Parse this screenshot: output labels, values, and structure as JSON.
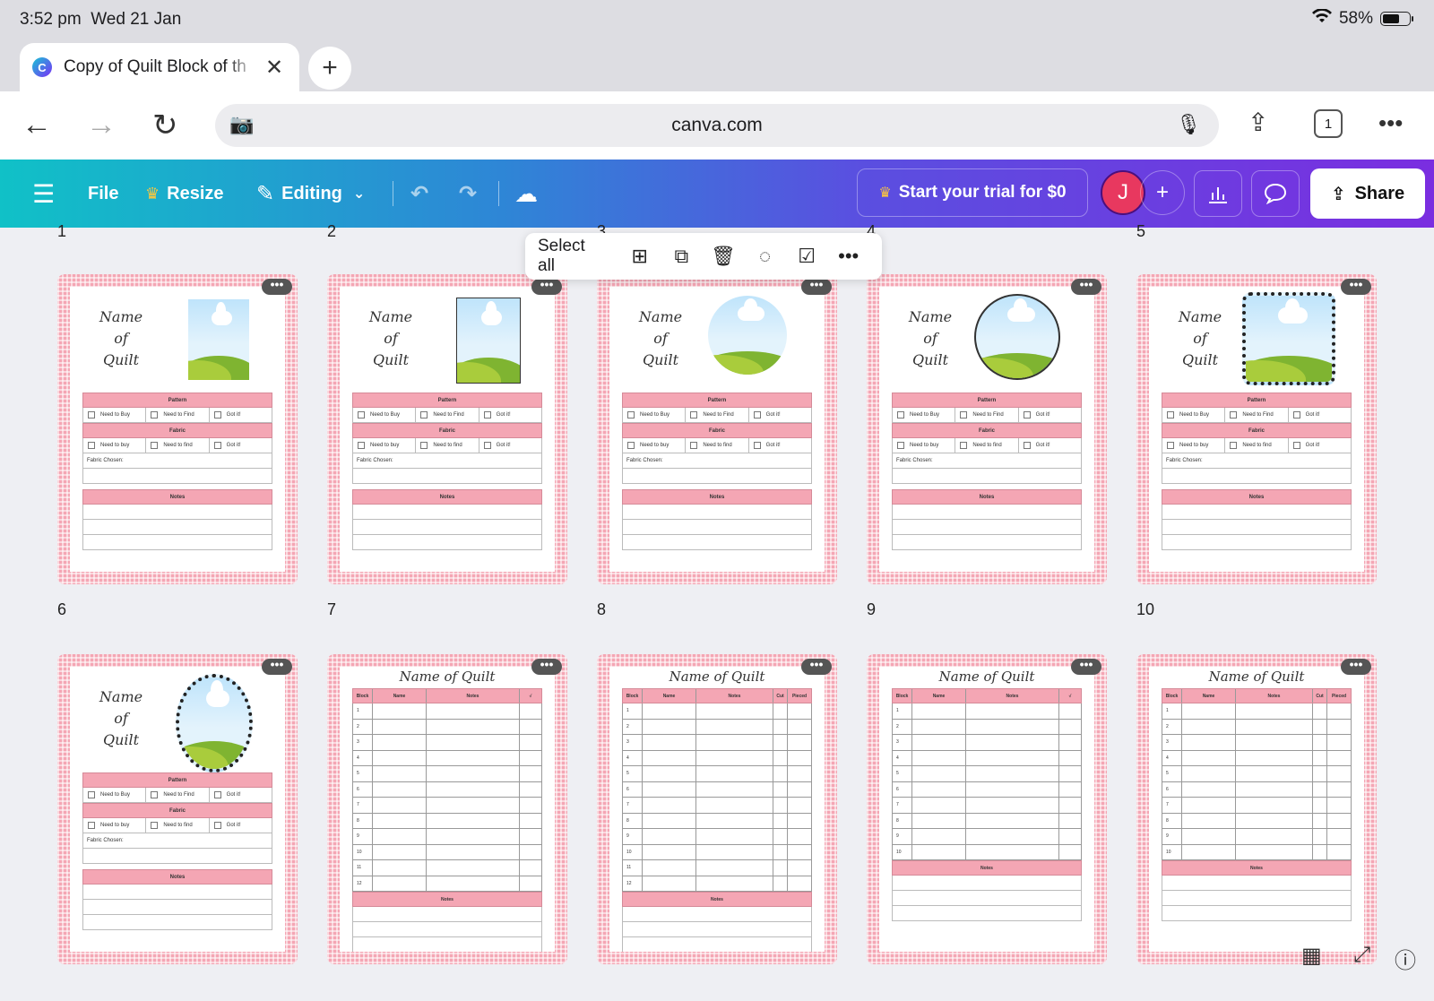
{
  "status": {
    "time": "3:52 pm",
    "date": "Wed 21 Jan",
    "battery": "58%",
    "battery_level": 0.58
  },
  "browser": {
    "tab_title": "Copy of Quilt Block of th",
    "url": "canva.com",
    "tab_count": "1"
  },
  "toolbar": {
    "file": "File",
    "resize": "Resize",
    "editing": "Editing",
    "trial": "Start your trial for $0",
    "avatar": "J",
    "share": "Share"
  },
  "context_menu": {
    "select_all": "Select all"
  },
  "pages": [
    {
      "num": "1",
      "kind": "cover"
    },
    {
      "num": "2",
      "kind": "cover"
    },
    {
      "num": "3",
      "kind": "cover"
    },
    {
      "num": "4",
      "kind": "cover"
    },
    {
      "num": "5",
      "kind": "cover"
    },
    {
      "num": "6",
      "kind": "cover"
    },
    {
      "num": "7",
      "kind": "table"
    },
    {
      "num": "8",
      "kind": "table"
    },
    {
      "num": "9",
      "kind": "table"
    },
    {
      "num": "10",
      "kind": "table"
    }
  ],
  "cover": {
    "title_line1": "Name",
    "title_line2": "of",
    "title_line3": "Quilt",
    "pattern": "Pattern",
    "need_to_buy": "Need to Buy",
    "need_to_find": "Need to Find",
    "got_it": "Got it!",
    "fabric": "Fabric",
    "need_to_buy_lc": "Need to buy",
    "need_to_find_lc": "Need to find",
    "fabric_chosen": "Fabric Chosen:",
    "notes": "Notes"
  },
  "table_page": {
    "title": "Name of Quilt",
    "col_block": "Block",
    "col_name": "Name",
    "col_notes": "Notes",
    "col_check": "√",
    "col_cut": "Cut",
    "col_pieced": "Pieced",
    "notes": "Notes"
  }
}
